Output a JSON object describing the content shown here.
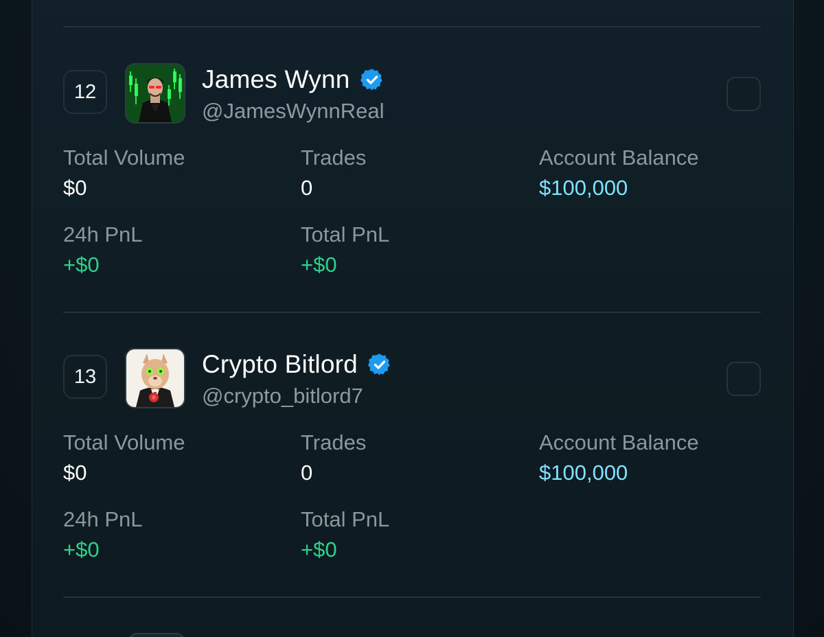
{
  "accent_colors": {
    "positive": "#2bd38a",
    "balance": "#7fe3ff",
    "verified": "#1d9bf0"
  },
  "traders": [
    {
      "rank": "12",
      "name": "James Wynn",
      "handle": "@JamesWynnReal",
      "verified_icon": "verified-badge-icon",
      "stats": {
        "total_volume_label": "Total Volume",
        "total_volume": "$0",
        "trades_label": "Trades",
        "trades": "0",
        "account_balance_label": "Account Balance",
        "account_balance": "$100,000",
        "pnl_24h_label": "24h PnL",
        "pnl_24h": "+$0",
        "total_pnl_label": "Total PnL",
        "total_pnl": "+$0"
      }
    },
    {
      "rank": "13",
      "name": "Crypto Bitlord",
      "handle": "@crypto_bitlord7",
      "verified_icon": "verified-badge-icon",
      "stats": {
        "total_volume_label": "Total Volume",
        "total_volume": "$0",
        "trades_label": "Trades",
        "trades": "0",
        "account_balance_label": "Account Balance",
        "account_balance": "$100,000",
        "pnl_24h_label": "24h PnL",
        "pnl_24h": "+$0",
        "total_pnl_label": "Total PnL",
        "total_pnl": "+$0"
      }
    }
  ]
}
